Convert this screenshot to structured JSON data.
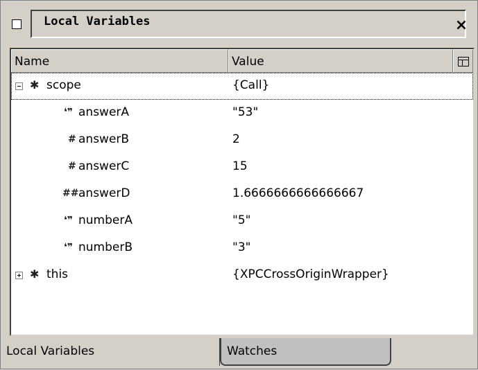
{
  "window": {
    "title": "Local Variables",
    "close_label": "×"
  },
  "columns": {
    "name": "Name",
    "value": "Value"
  },
  "rows": [
    {
      "name": "scope",
      "value": "{Call}",
      "icon": "object-icon",
      "expander": "minus",
      "selected": true
    },
    {
      "name": "answerA",
      "value": "\"53\"",
      "icon": "string-icon"
    },
    {
      "name": "answerB",
      "value": "2",
      "icon": "number-icon"
    },
    {
      "name": "answerC",
      "value": "15",
      "icon": "number-icon"
    },
    {
      "name": "answerD",
      "value": "1.6666666666666667",
      "icon": "double-icon"
    },
    {
      "name": "numberA",
      "value": "\"5\"",
      "icon": "string-icon"
    },
    {
      "name": "numberB",
      "value": "\"3\"",
      "icon": "string-icon"
    },
    {
      "name": "this",
      "value": "{XPCCrossOriginWrapper}",
      "icon": "object-icon",
      "expander": "plus"
    }
  ],
  "tabs": {
    "local": "Local Variables",
    "watches": "Watches"
  }
}
